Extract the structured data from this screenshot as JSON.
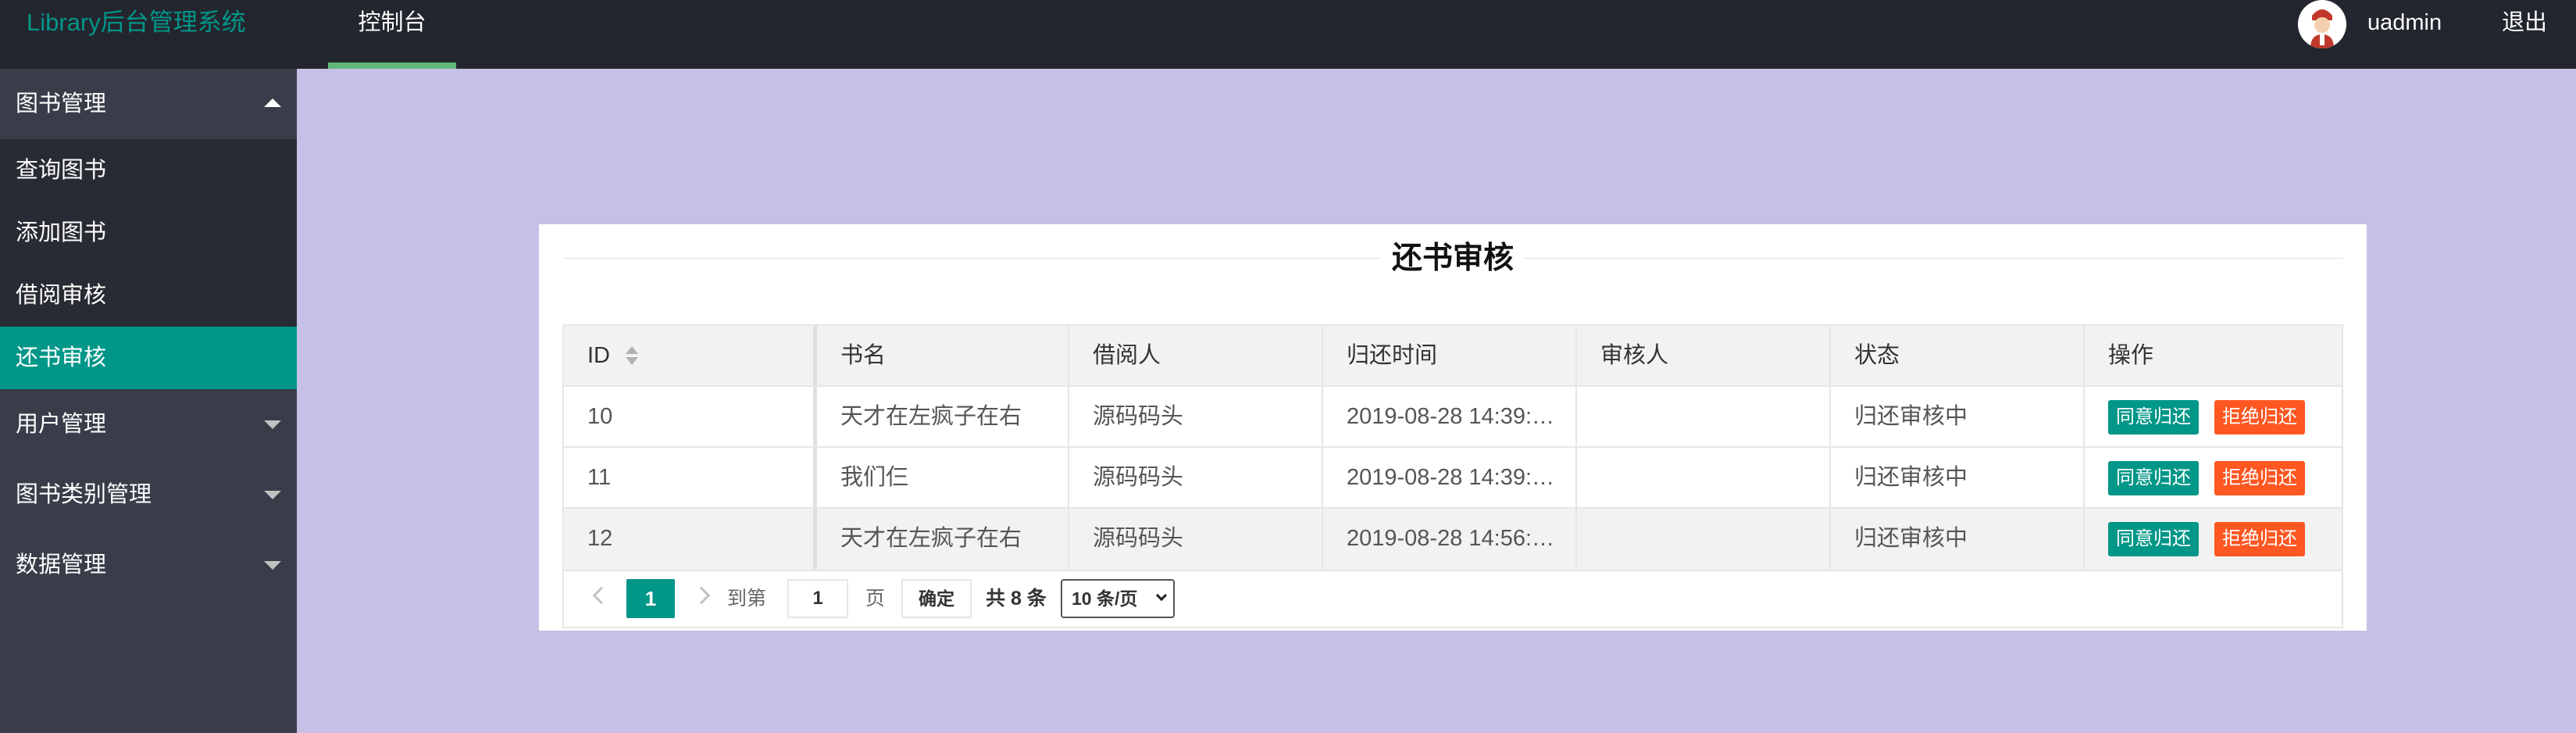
{
  "header": {
    "logo": "Library后台管理系统",
    "nav": [
      {
        "label": "控制台"
      }
    ],
    "username": "uadmin",
    "logout": "退出"
  },
  "sidebar": {
    "groups": [
      {
        "label": "图书管理",
        "expanded": true,
        "items": [
          {
            "label": "查询图书"
          },
          {
            "label": "添加图书"
          },
          {
            "label": "借阅审核"
          },
          {
            "label": "还书审核",
            "active": true
          }
        ]
      },
      {
        "label": "用户管理",
        "expanded": false
      },
      {
        "label": "图书类别管理",
        "expanded": false
      },
      {
        "label": "数据管理",
        "expanded": false
      }
    ]
  },
  "main": {
    "title": "还书审核",
    "table": {
      "headers": [
        "ID",
        "书名",
        "借阅人",
        "归还时间",
        "审核人",
        "状态",
        "操作"
      ],
      "rows": [
        {
          "id": "10",
          "book": "天才在左疯子在右",
          "borrower": "源码码头",
          "return_time": "2019-08-28 14:39:…",
          "reviewer": "",
          "status": "归还审核中"
        },
        {
          "id": "11",
          "book": "我们仨",
          "borrower": "源码码头",
          "return_time": "2019-08-28 14:39:…",
          "reviewer": "",
          "status": "归还审核中"
        },
        {
          "id": "12",
          "book": "天才在左疯子在右",
          "borrower": "源码码头",
          "return_time": "2019-08-28 14:56:…",
          "reviewer": "",
          "status": "归还审核中"
        }
      ],
      "approve_label": "同意归还",
      "reject_label": "拒绝归还"
    },
    "pagination": {
      "current": "1",
      "goto_prefix": "到第",
      "goto_value": "1",
      "goto_suffix": "页",
      "confirm": "确定",
      "total": "共 8 条",
      "page_size": "10 条/页"
    }
  },
  "colors": {
    "accent": "#009688",
    "danger": "#ff5722",
    "header_bg": "#23262e",
    "sidebar_bg": "#393d49",
    "content_bg": "#c7c0e6"
  }
}
